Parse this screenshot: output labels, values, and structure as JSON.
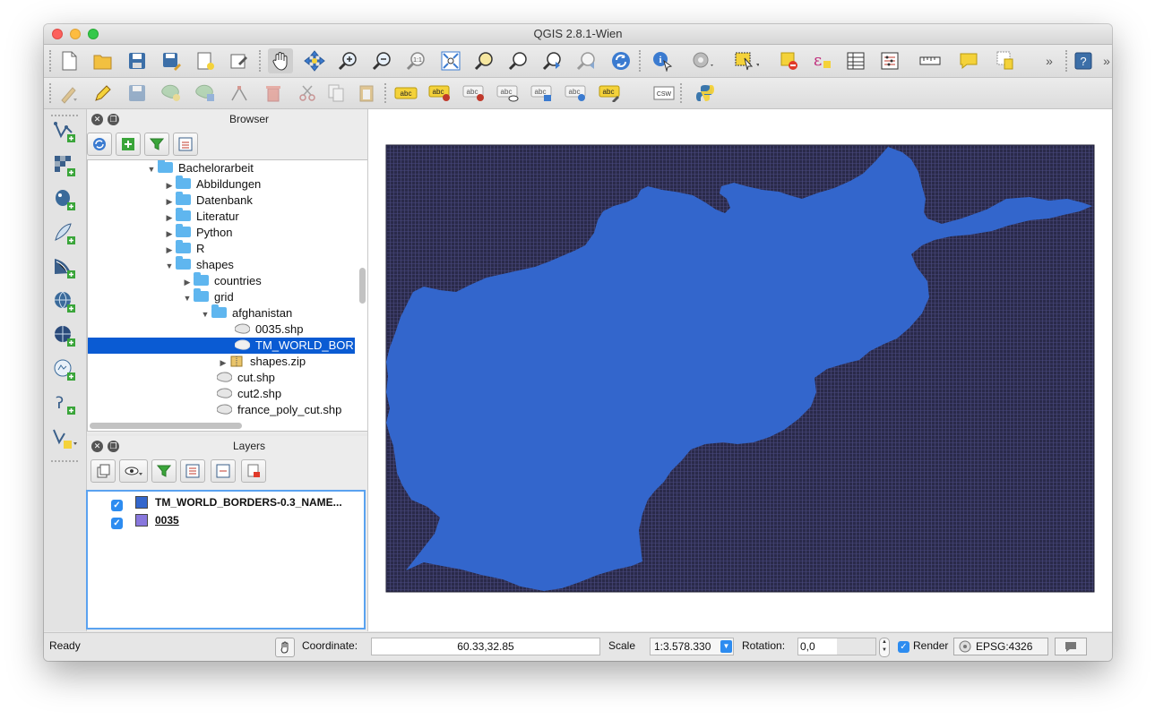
{
  "window": {
    "title": "QGIS 2.8.1-Wien"
  },
  "browser_panel": {
    "title": "Browser",
    "tree": [
      {
        "label": "Bachelorarbeit",
        "type": "folder",
        "expanded": true
      },
      {
        "label": "Abbildungen",
        "type": "folder",
        "expanded": false
      },
      {
        "label": "Datenbank",
        "type": "folder",
        "expanded": false
      },
      {
        "label": "Literatur",
        "type": "folder",
        "expanded": false
      },
      {
        "label": "Python",
        "type": "folder",
        "expanded": false
      },
      {
        "label": "R",
        "type": "folder",
        "expanded": false
      },
      {
        "label": "shapes",
        "type": "folder",
        "expanded": true
      },
      {
        "label": "countries",
        "type": "folder",
        "expanded": false
      },
      {
        "label": "grid",
        "type": "folder",
        "expanded": true
      },
      {
        "label": "afghanistan",
        "type": "folder",
        "expanded": true
      },
      {
        "label": "0035.shp",
        "type": "shapefile"
      },
      {
        "label": "TM_WORLD_BOR",
        "type": "shapefile",
        "selected": true
      },
      {
        "label": "shapes.zip",
        "type": "zip",
        "expanded": false
      },
      {
        "label": "cut.shp",
        "type": "shapefile"
      },
      {
        "label": "cut2.shp",
        "type": "shapefile"
      },
      {
        "label": "france_poly_cut.shp",
        "type": "shapefile"
      }
    ]
  },
  "layers_panel": {
    "title": "Layers",
    "layers": [
      {
        "name": "TM_WORLD_BORDERS-0.3_NAME...",
        "checked": true,
        "color": "#3366cc"
      },
      {
        "name": "0035",
        "checked": true,
        "color": "#8877dd"
      }
    ]
  },
  "map": {
    "background": "#2a2a4a",
    "polygon_color": "#3366cc"
  },
  "status": {
    "ready": "Ready",
    "coordinate_label": "Coordinate:",
    "coordinate_value": "60.33,32.85",
    "scale_label": "Scale",
    "scale_value": "1:3.578.330",
    "rotation_label": "Rotation:",
    "rotation_value": "0,0",
    "render_label": "Render",
    "render_checked": true,
    "crs": "EPSG:4326"
  },
  "toolbar_text": {
    "abc": "abc",
    "csw": "CSW"
  }
}
